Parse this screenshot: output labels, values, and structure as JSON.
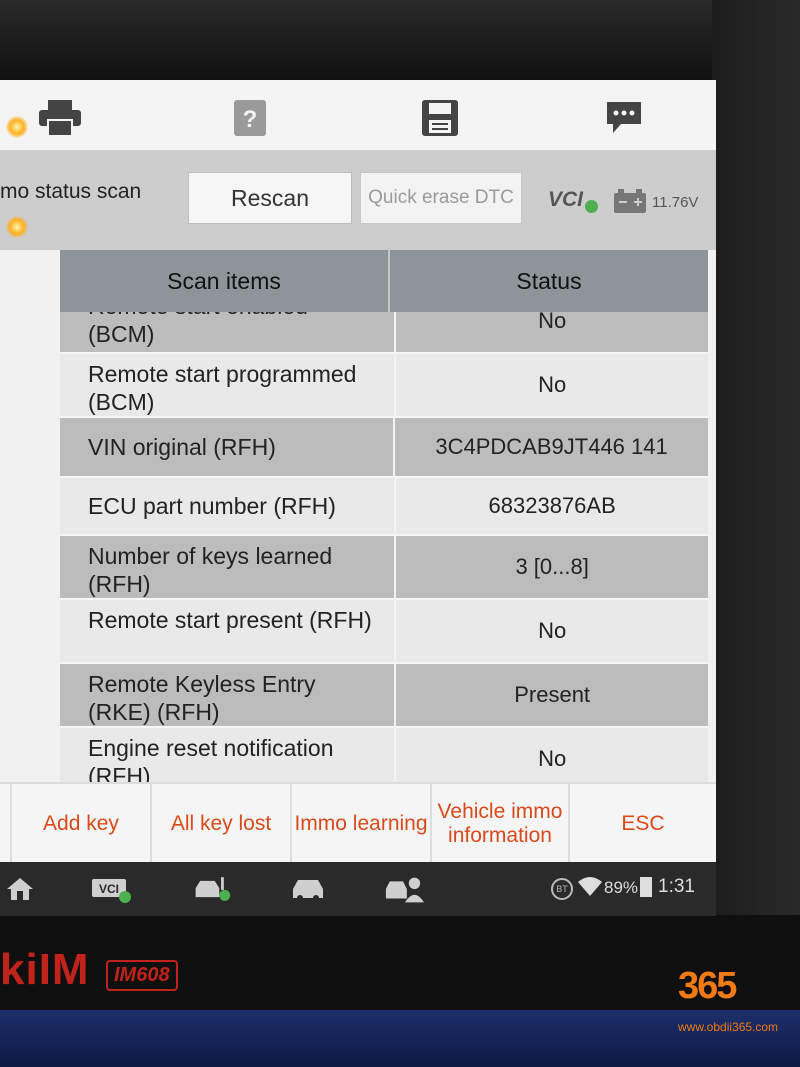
{
  "toolbar": {
    "icons": [
      "print-icon",
      "help-icon",
      "save-icon",
      "message-icon"
    ]
  },
  "header": {
    "title": "mo status scan",
    "rescan_label": "Rescan",
    "quick_erase_label": "Quick erase DTC",
    "vci_label": "VCI",
    "voltage": "11.76V"
  },
  "table": {
    "headers": {
      "item": "Scan items",
      "status": "Status"
    },
    "rows": [
      {
        "item": "Remote start enabled (BCM)",
        "status": "No"
      },
      {
        "item": "Remote start programmed (BCM)",
        "status": "No"
      },
      {
        "item": "VIN original (RFH)",
        "status": "3C4PDCAB9JT446 141"
      },
      {
        "item": "ECU part number (RFH)",
        "status": "68323876AB"
      },
      {
        "item": "Number of keys learned (RFH)",
        "status": "3 [0...8]"
      },
      {
        "item": "Remote start present (RFH)",
        "status": "No"
      },
      {
        "item": "Remote Keyless Entry (RKE) (RFH)",
        "status": "Present"
      },
      {
        "item": "Engine reset notification (RFH)",
        "status": "No"
      }
    ]
  },
  "functions": {
    "add_key": "Add key",
    "all_key_lost": "All key lost",
    "immo_learning": "Immo learning",
    "vehicle_immo_information": "Vehicle immo information",
    "esc": "ESC"
  },
  "statusbar": {
    "bt": "BT",
    "battery": "89%",
    "time": "1:31"
  },
  "device": {
    "brand": "kiIM",
    "model": "IM608"
  },
  "watermark": {
    "logo": "365",
    "url": "www.obdii365.com"
  },
  "colors": {
    "function_text": "#d84a1a",
    "header_row": "#8e959a",
    "row_odd": "#bcbcbc",
    "row_even": "#e9e9e9",
    "brand_red": "#c0231b"
  }
}
